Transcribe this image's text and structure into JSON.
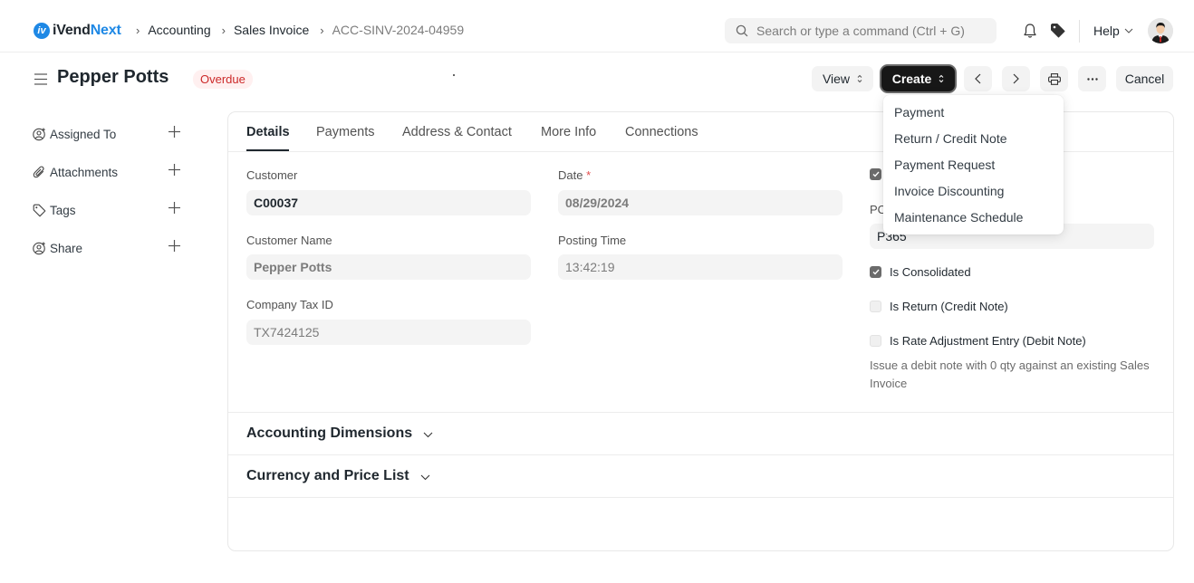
{
  "navbar": {
    "logo_mark": "iv",
    "logo_text_main": "iVend",
    "logo_text_accent": "Next",
    "breadcrumbs": [
      "Accounting",
      "Sales Invoice",
      "ACC-SINV-2024-04959"
    ],
    "search_placeholder": "Search or type a command (Ctrl + G)",
    "help_label": "Help"
  },
  "page": {
    "title": "Pepper Potts",
    "status": "Overdue",
    "status_color": "#cc2929",
    "actions": {
      "view": "View",
      "create": "Create",
      "cancel": "Cancel"
    }
  },
  "sidebar": {
    "items": [
      {
        "label": "Assigned To",
        "icon": "assign-user-icon"
      },
      {
        "label": "Attachments",
        "icon": "paperclip-icon"
      },
      {
        "label": "Tags",
        "icon": "tag-icon"
      },
      {
        "label": "Share",
        "icon": "share-user-icon"
      }
    ]
  },
  "tabs": [
    "Details",
    "Payments",
    "Address & Contact",
    "More Info",
    "Connections"
  ],
  "active_tab": "Details",
  "form": {
    "customer": {
      "label": "Customer",
      "value": "C00037"
    },
    "date": {
      "label": "Date",
      "required_mark": "*",
      "value": "08/29/2024"
    },
    "customer_name": {
      "label": "Customer Name",
      "value": "Pepper Potts"
    },
    "posting_time": {
      "label": "Posting Time",
      "value": "13:42:19"
    },
    "company_tax_id": {
      "label": "Company Tax ID",
      "value": "TX7424125"
    },
    "po_label_partial": "PO",
    "po_value": "P365",
    "checkboxes": [
      {
        "label": "Is Consolidated",
        "checked": true
      },
      {
        "label": "Is Return (Credit Note)",
        "checked": false
      },
      {
        "label": "Is Rate Adjustment Entry (Debit Note)",
        "checked": false
      }
    ],
    "top_checkbox_checked": true,
    "rate_adjustment_help": "Issue a debit note with 0 qty against an existing Sales Invoice"
  },
  "sections": [
    "Accounting Dimensions",
    "Currency and Price List"
  ],
  "create_menu": {
    "items": [
      "Payment",
      "Return / Credit Note",
      "Payment Request",
      "Invoice Discounting",
      "Maintenance Schedule"
    ]
  }
}
